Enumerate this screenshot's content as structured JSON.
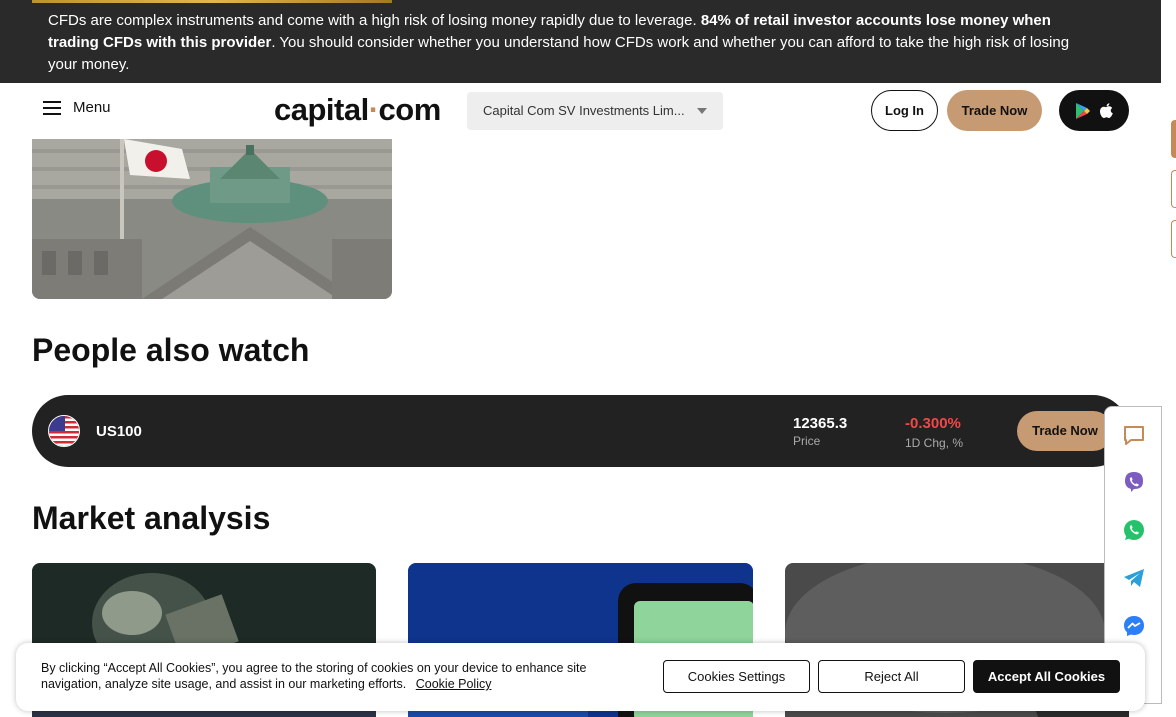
{
  "risk_banner": {
    "text_start": "CFDs are complex instruments and come with a high risk of losing money rapidly due to leverage. ",
    "text_bold": "84% of retail investor accounts lose money when trading CFDs with this provider",
    "text_end": ". You should consider whether you understand how CFDs work and whether you can afford to take the high risk of losing your money."
  },
  "header": {
    "menu_label": "Menu",
    "logo_left": "capital",
    "logo_dot": "·",
    "logo_right": "com",
    "entity_select": "Capital Com SV Investments Lim...",
    "login_label": "Log In",
    "trade_now_label": "Trade Now"
  },
  "people_also_watch": {
    "title": "People also watch",
    "items": [
      {
        "symbol": "US100",
        "price": "12365.3",
        "price_label": "Price",
        "change": "-0.300%",
        "change_label": "1D Chg, %",
        "trade_label": "Trade Now"
      }
    ]
  },
  "market_analysis": {
    "title": "Market analysis"
  },
  "cookie_banner": {
    "text": "By clicking “Accept All Cookies”, you agree to the storing of cookies on your device to enhance site navigation, analyze site usage, and assist in our marketing efforts.",
    "policy_link": "Cookie Policy",
    "settings_label": "Cookies Settings",
    "reject_label": "Reject All",
    "accept_label": "Accept All Cookies"
  },
  "colors": {
    "banner_bg": "#2a2a2a",
    "accent": "#c69a72",
    "negative": "#f04848",
    "dark_row": "#222222"
  },
  "social_icons": [
    "chat-icon",
    "viber-icon",
    "whatsapp-icon",
    "telegram-icon",
    "messenger-icon"
  ]
}
